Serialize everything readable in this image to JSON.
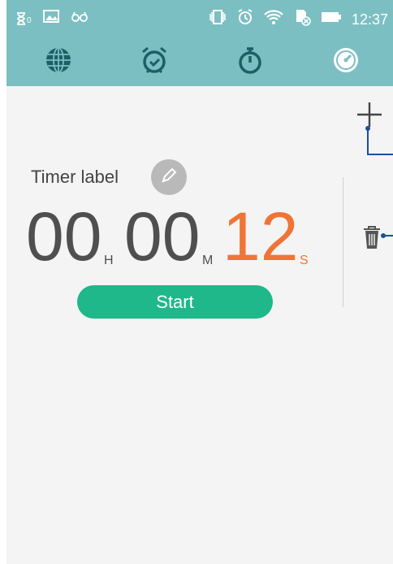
{
  "status_bar": {
    "time": "12:37",
    "left_icons": [
      "hourglass-icon",
      "image-icon",
      "glasses-icon"
    ],
    "left_hourglass_count": "0",
    "right_icons": [
      "vibrate-icon",
      "alarm-icon",
      "wifi-icon",
      "no-sd-icon",
      "battery-icon"
    ]
  },
  "tabs": [
    {
      "name": "world-clock",
      "icon": "globe-icon"
    },
    {
      "name": "alarm",
      "icon": "alarm-clock-icon"
    },
    {
      "name": "stopwatch",
      "icon": "stopwatch-icon"
    },
    {
      "name": "timer",
      "icon": "timer-icon",
      "selected": true
    }
  ],
  "timer": {
    "label": "Timer label",
    "hours": "00",
    "hours_unit": "H",
    "minutes": "00",
    "minutes_unit": "M",
    "seconds": "12",
    "seconds_unit": "S",
    "start_label": "Start"
  },
  "colors": {
    "toolbar": "#7cbfc2",
    "background": "#f4f4f4",
    "digits": "#4f4f4f",
    "seconds": "#f07438",
    "start_button": "#1fb88a",
    "annotation": "#1a4f9c"
  }
}
